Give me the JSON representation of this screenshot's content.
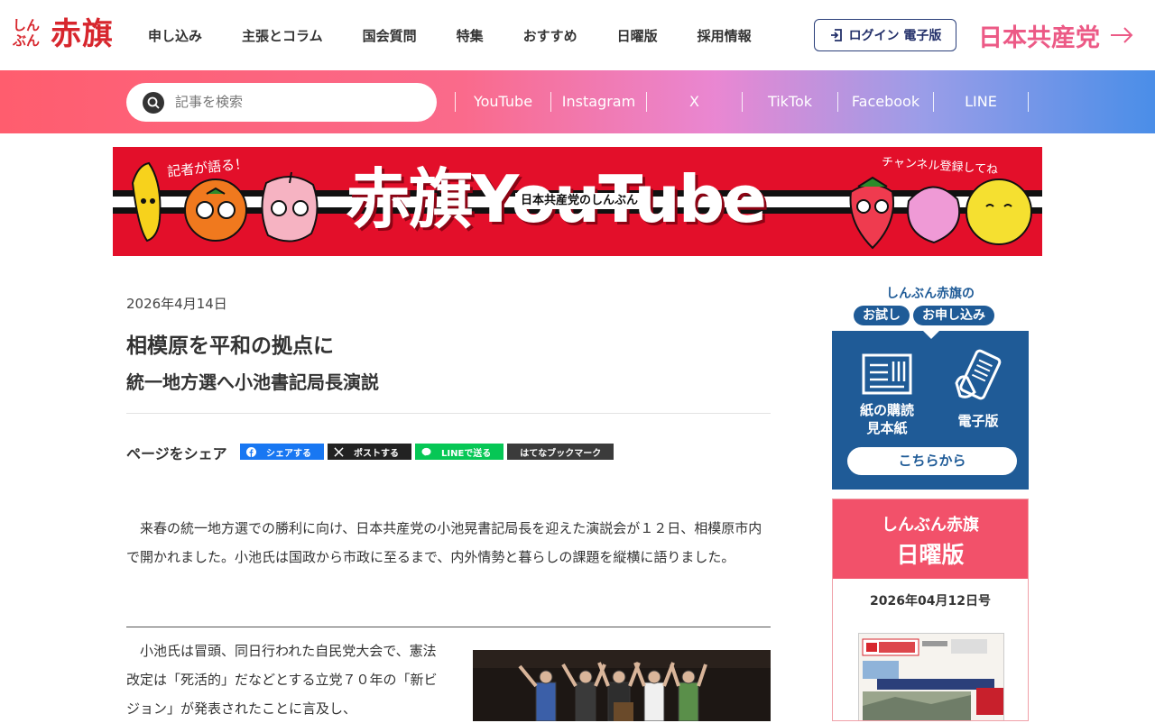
{
  "header": {
    "logo_small": "しんぶん",
    "logo_big": "赤旗",
    "nav": [
      {
        "label": "申し込み"
      },
      {
        "label": "主張とコラム"
      },
      {
        "label": "国会質問"
      },
      {
        "label": "特集"
      },
      {
        "label": "おすすめ"
      },
      {
        "label": "日曜版"
      },
      {
        "label": "採用情報"
      }
    ],
    "login_label": "ログイン 電子版",
    "party_label": "日本共産党"
  },
  "searchbar": {
    "placeholder": "記事を検索",
    "social": [
      "YouTube",
      "Instagram",
      "X",
      "TikTok",
      "Facebook",
      "LINE"
    ]
  },
  "banner": {
    "title": "赤旗YouTube",
    "subtitle": "日本共産党のしんぶん",
    "hand_left": "記者が語る！",
    "hand_right": "チャンネル登録してね"
  },
  "article": {
    "date": "2026年4月14日",
    "title": "相模原を平和の拠点に",
    "subtitle": "統一地方選へ小池書記局長演説",
    "share_label": "ページをシェア",
    "share_buttons": {
      "facebook": "シェアする",
      "x": "ポストする",
      "line": "LINEで送る",
      "hatena": "はてなブックマーク"
    },
    "para1": "来春の統一地方選での勝利に向け、日本共産党の小池晃書記局長を迎えた演説会が１２日、相模原市内で開かれました。小池氏は国政から市政に至るまで、内外情勢と暮らしの課題を縦横に語りました。",
    "para2": "小池氏は冒頭、同日行われた自民党大会で、憲法改定は「死活的」だなどとする立党７０年の「新ビジョン」が発表されたことに言及し、"
  },
  "sidebar": {
    "trial_heading": "しんぶん赤旗の",
    "trial_pill1": "お試し",
    "trial_pill2": "お申し込み",
    "paper_label_line1": "紙の購読",
    "paper_label_line2": "見本紙",
    "digital_label": "電子版",
    "cta": "こちらから",
    "sunday_line1": "しんぶん赤旗",
    "sunday_line2": "日曜版",
    "sunday_issue": "2026年04月12日号"
  },
  "colors": {
    "brand_red": "#d7262d",
    "party_pink": "#ec5a86",
    "navy": "#1f5b97",
    "sunday_pink": "#f2516a"
  }
}
